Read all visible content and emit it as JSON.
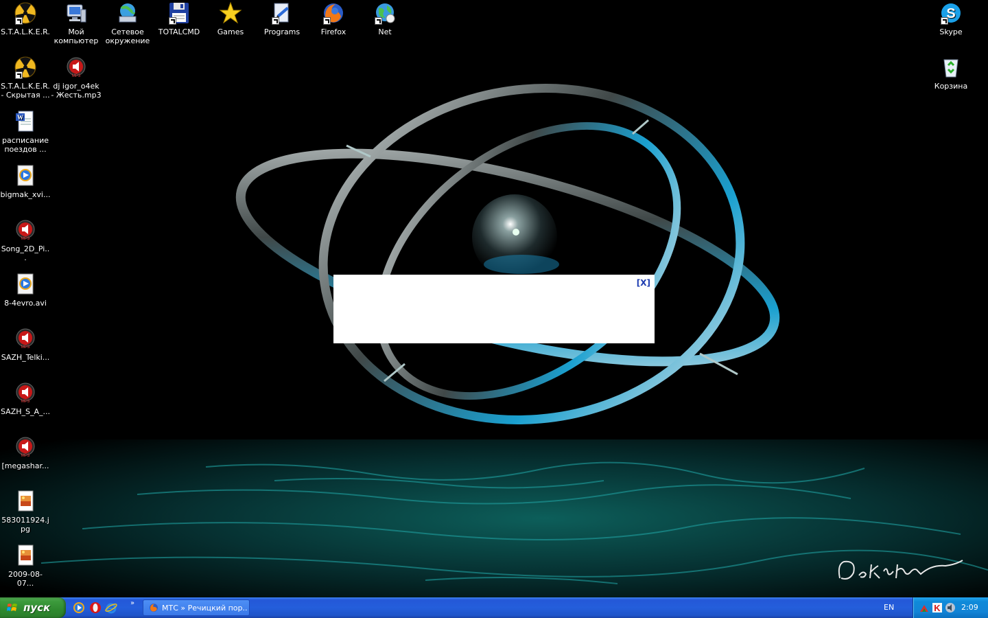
{
  "desktop": {
    "icons": [
      {
        "id": "stalker",
        "label": "S.T.A.L.K.E.R.",
        "icon": "radiation-icon"
      },
      {
        "id": "my-computer",
        "label": "Мой компьютер",
        "icon": "computer-icon"
      },
      {
        "id": "network",
        "label": "Сетевое окружение",
        "icon": "network-icon"
      },
      {
        "id": "totalcmd",
        "label": "TOTALCMD",
        "icon": "floppy-icon"
      },
      {
        "id": "games",
        "label": "Games",
        "icon": "star-icon"
      },
      {
        "id": "programs",
        "label": "Programs",
        "icon": "document-pen-icon"
      },
      {
        "id": "firefox",
        "label": "Firefox",
        "icon": "firefox-icon"
      },
      {
        "id": "net",
        "label": "Net",
        "icon": "globe-icon"
      },
      {
        "id": "skype",
        "label": "Skype",
        "icon": "skype-icon"
      },
      {
        "id": "stalker2",
        "label": "S.T.A.L.K.E.R. - Скрытая ...",
        "icon": "radiation-icon"
      },
      {
        "id": "dj-mp3",
        "label": "dj igor_o4ek - Жесть.mp3",
        "icon": "mp3-icon"
      },
      {
        "id": "recycle",
        "label": "Корзина",
        "icon": "recycle-bin-icon"
      },
      {
        "id": "schedule-doc",
        "label": "расписание поездов ...",
        "icon": "word-doc-icon"
      },
      {
        "id": "bigmak",
        "label": "bigmak_xvi...",
        "icon": "media-player-icon"
      },
      {
        "id": "song2d",
        "label": "Song_2D_Pi...",
        "icon": "mp3-icon"
      },
      {
        "id": "evro",
        "label": "8-4evro.avi",
        "icon": "media-player-icon"
      },
      {
        "id": "sazh-telki",
        "label": "SAZH_Telki...",
        "icon": "mp3-icon"
      },
      {
        "id": "sazh-s-a",
        "label": "SAZH_S_A_...",
        "icon": "mp3-icon"
      },
      {
        "id": "megashar",
        "label": "[megashar...",
        "icon": "mp3-icon"
      },
      {
        "id": "jpg1",
        "label": "583011924.jpg",
        "icon": "image-file-icon"
      },
      {
        "id": "jpg2",
        "label": "2009-08-07...",
        "icon": "image-file-icon"
      }
    ]
  },
  "popup": {
    "close_label": "[X]"
  },
  "taskbar": {
    "start_label": "пуск",
    "quick_launch": [
      {
        "name": "media-player-quick-icon"
      },
      {
        "name": "opera-quick-icon"
      },
      {
        "name": "ie-quick-icon"
      }
    ],
    "chevron": "»",
    "task_button_label": "МТС » Речицкий пор...",
    "language": "EN",
    "tray_icons": [
      "network-tray-icon",
      "kaspersky-tray-icon",
      "speaker-tray-icon"
    ],
    "clock": "2:09"
  },
  "colors": {
    "taskbar_blue": "#245edb",
    "start_green": "#3c9a3c",
    "tray_blue": "#0f8ad9",
    "close_link": "#1c3bb0"
  }
}
